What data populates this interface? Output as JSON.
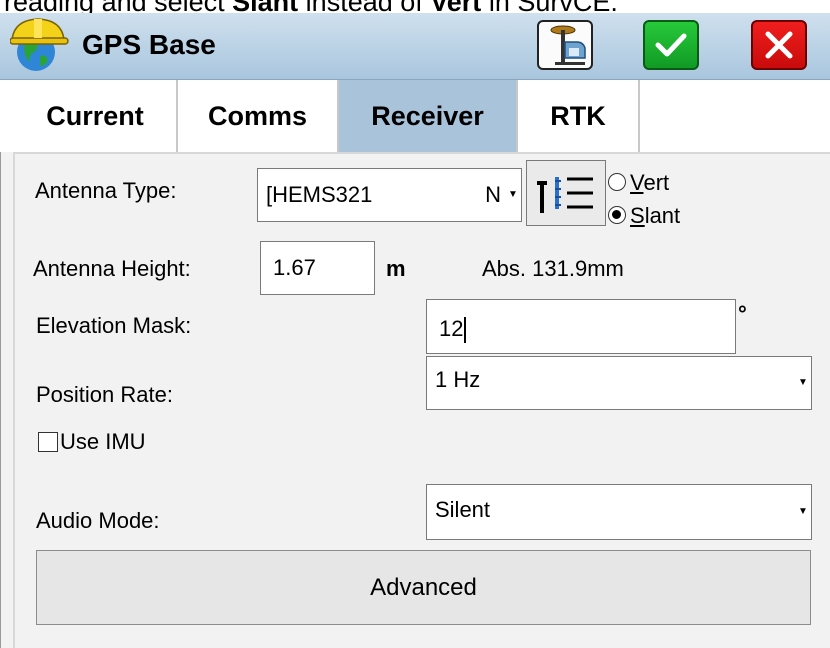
{
  "caption": {
    "pre": "reading and select ",
    "slant": "Slant",
    "mid": " instead of ",
    "vert": "Vert",
    "post": " in SurvCE."
  },
  "titlebar": {
    "title": "GPS Base"
  },
  "tabs": [
    {
      "label": "Current"
    },
    {
      "label": "Comms"
    },
    {
      "label": "Receiver"
    },
    {
      "label": "RTK"
    }
  ],
  "antenna_type": {
    "label": "Antenna Type:",
    "value": "[HEMS321",
    "suffix": "N"
  },
  "measure_type": {
    "vert_prefix": "",
    "vert_key": "V",
    "vert_rest": "ert",
    "slant_key": "S",
    "slant_rest": "lant",
    "selected": "Slant"
  },
  "antenna_height": {
    "label": "Antenna Height:",
    "value": "1.67",
    "unit": "m",
    "abs": "Abs. 131.9mm"
  },
  "elevation_mask": {
    "label": "Elevation Mask:",
    "value": "12",
    "unit": "°"
  },
  "position_rate": {
    "label": "Position Rate:",
    "value": "1 Hz"
  },
  "use_imu": {
    "label": "Use IMU",
    "checked": false
  },
  "audio_mode": {
    "label": "Audio Mode:",
    "value": "Silent"
  },
  "advanced_button": {
    "label": "Advanced"
  },
  "colors": {
    "titlebar": "#bcd4e8",
    "active_tab": "#a8c3da",
    "ok_green": "#1fb131",
    "cancel_red": "#e01414"
  }
}
